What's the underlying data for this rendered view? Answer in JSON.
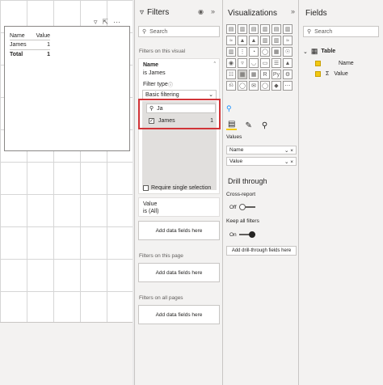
{
  "canvas": {
    "table": {
      "headers": [
        "Name",
        "Value"
      ],
      "rows": [
        [
          "James",
          "1"
        ]
      ],
      "total": [
        "Total",
        "1"
      ]
    }
  },
  "filters": {
    "title": "Filters",
    "search_placeholder": "Search",
    "section_visual": "Filters on this visual",
    "name_card": {
      "field": "Name",
      "summary": "is James",
      "filter_type_label": "Filter type",
      "filter_type_value": "Basic filtering",
      "search_value": "Ja",
      "items": [
        {
          "label": "James",
          "count": "1"
        }
      ],
      "require_single": "Require single selection"
    },
    "value_card": {
      "field": "Value",
      "summary": "is (All)"
    },
    "add_fields": "Add data fields here",
    "section_page": "Filters on this page",
    "section_all": "Filters on all pages"
  },
  "viz": {
    "title": "Visualizations",
    "icons": [
      "bar",
      "col",
      "sbar",
      "scol",
      "cbar",
      "ccol",
      "line",
      "area",
      "sarea",
      "lcol",
      "lcol2",
      "ribbon",
      "water",
      "scatter",
      "pie",
      "donut",
      "tree",
      "map",
      "fmap",
      "funnel",
      "gauge",
      "card",
      "mcard",
      "kpi",
      "slicer",
      "table",
      "matrix",
      "R",
      "Py",
      "key",
      "decomp",
      "qa",
      "more",
      "arc",
      "",
      ""
    ],
    "values_label": "Values",
    "wells": [
      {
        "label": "Name"
      },
      {
        "label": "Value"
      }
    ],
    "drill_title": "Drill through",
    "cross_report": "Cross-report",
    "cross_state": "Off",
    "keep_filters": "Keep all filters",
    "keep_state": "On",
    "add_drill": "Add drill-through fields here"
  },
  "fields": {
    "title": "Fields",
    "search_placeholder": "Search",
    "table_name": "Table",
    "items": [
      {
        "label": "Name",
        "sigma": ""
      },
      {
        "label": "Value",
        "sigma": "Σ"
      }
    ]
  }
}
